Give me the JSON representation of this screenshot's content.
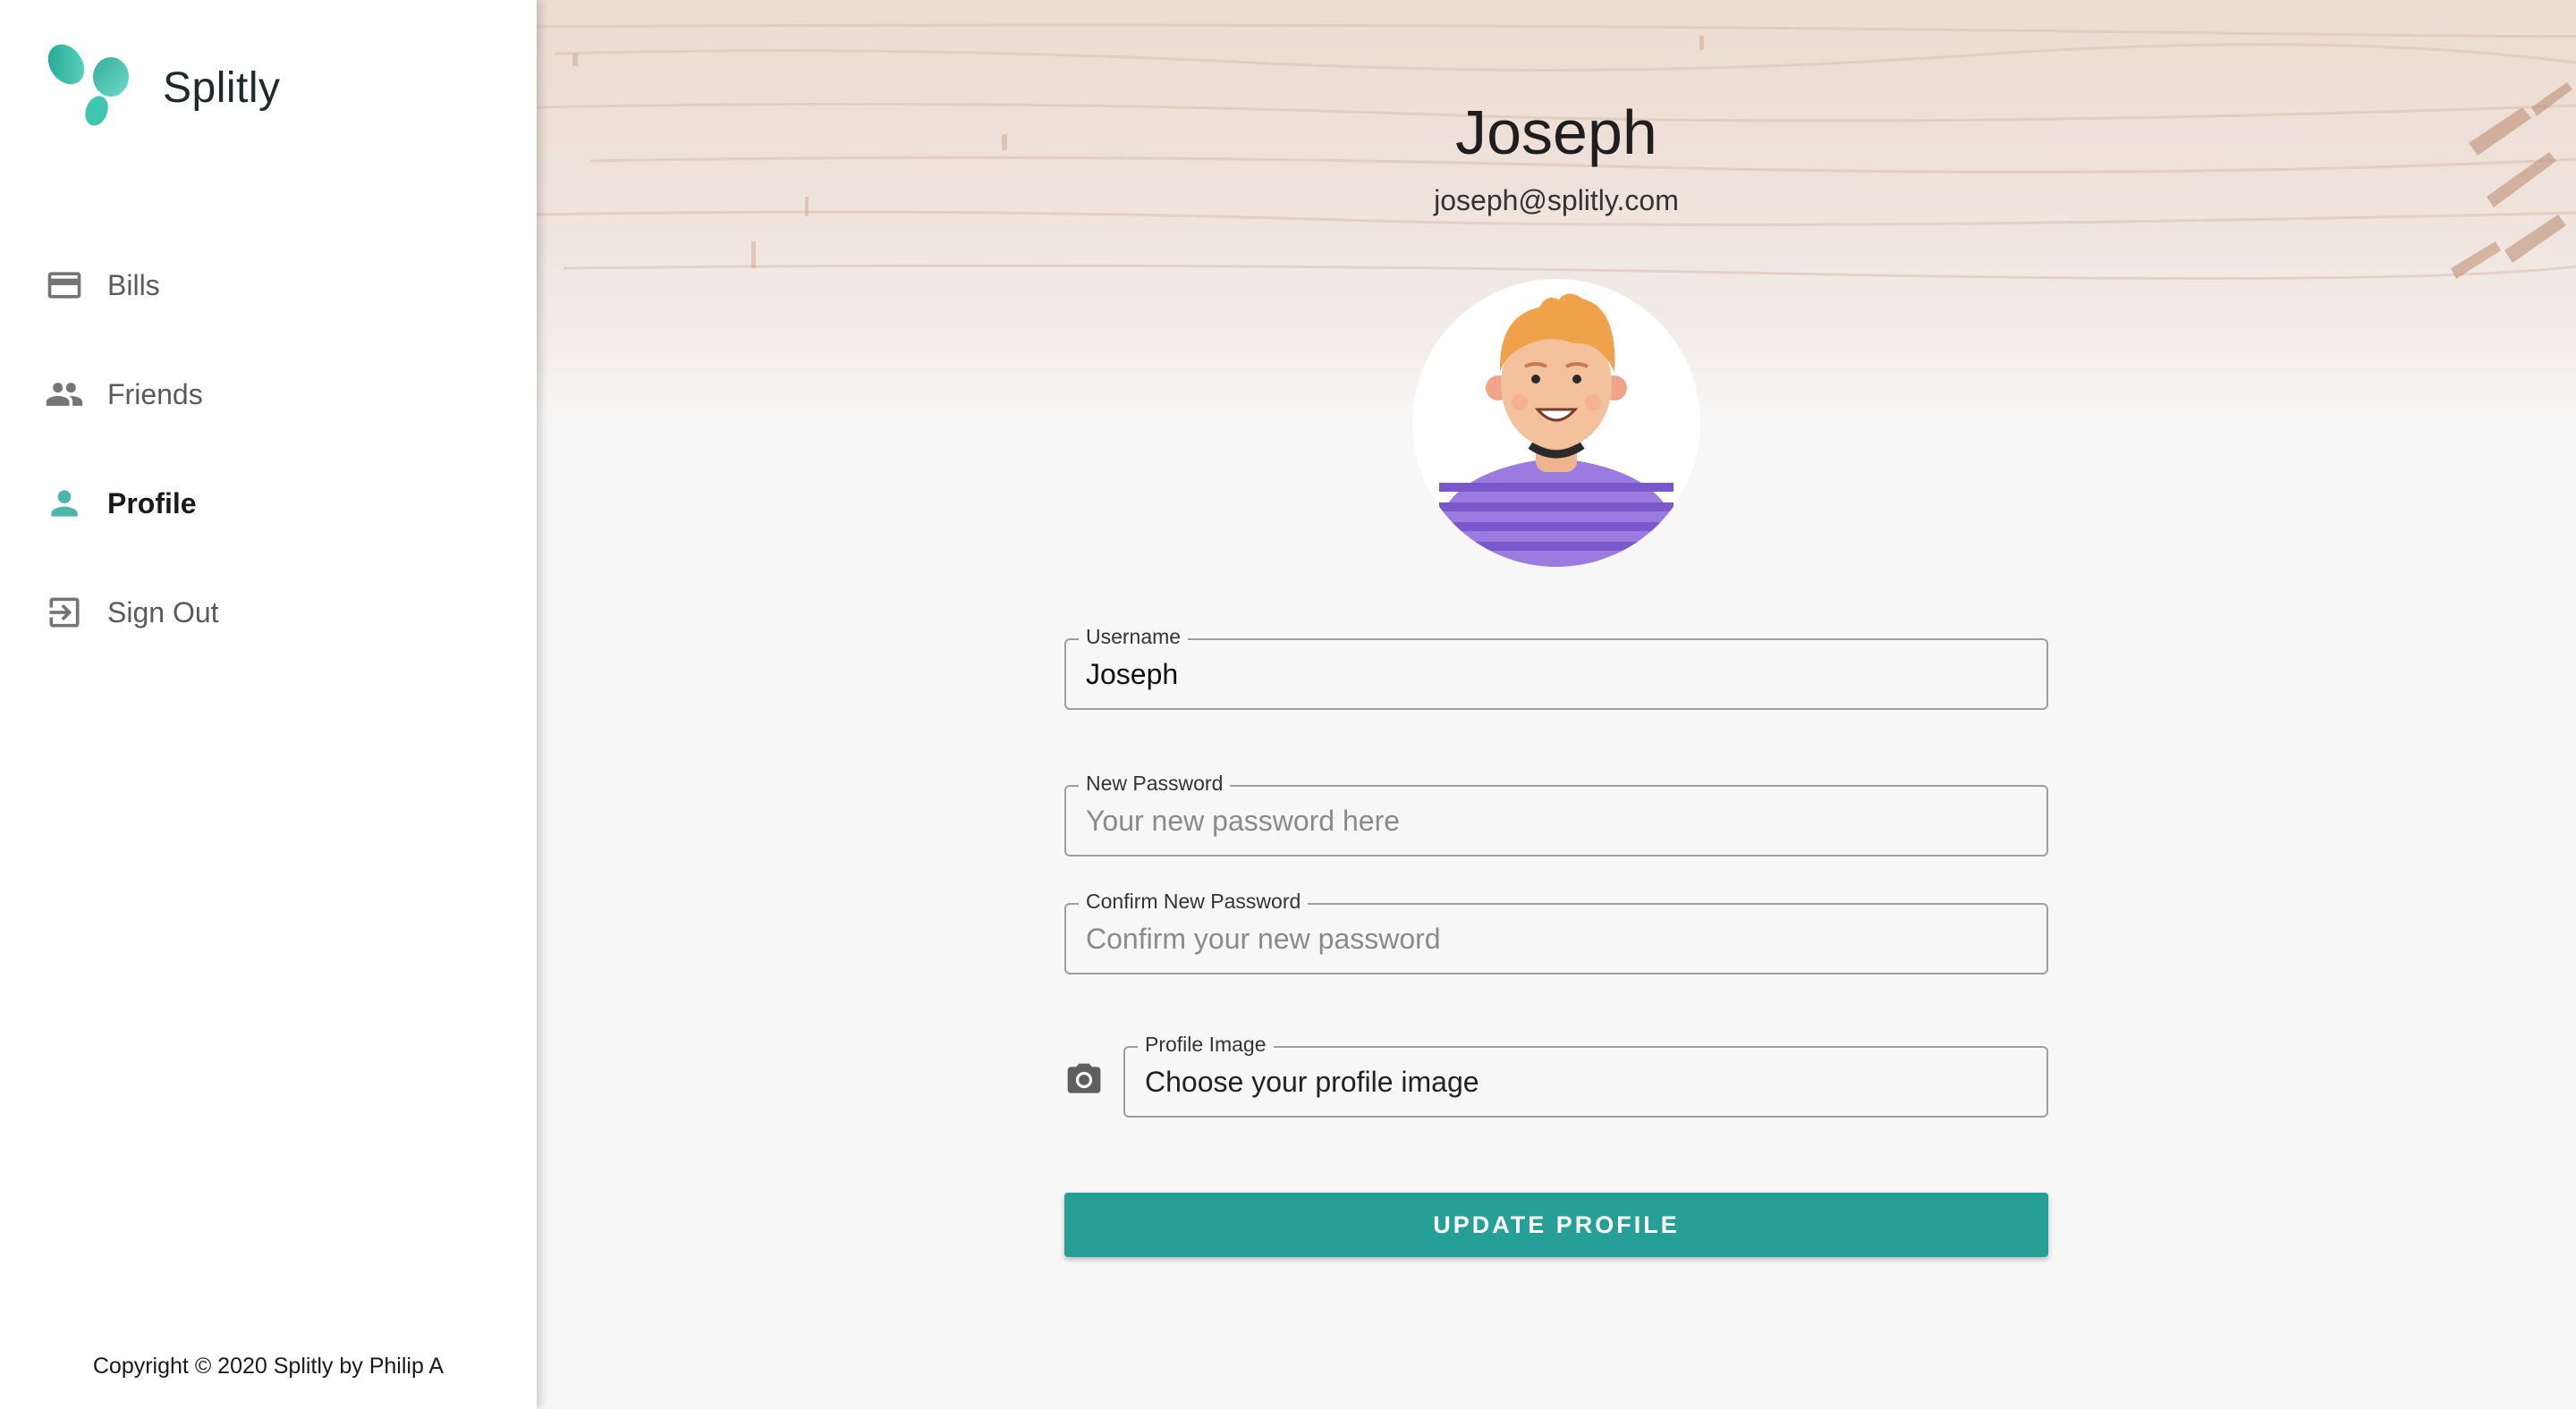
{
  "app": {
    "name": "Splitly"
  },
  "sidebar": {
    "items": [
      {
        "label": "Bills",
        "icon": "credit-card-icon",
        "active": false
      },
      {
        "label": "Friends",
        "icon": "people-icon",
        "active": false
      },
      {
        "label": "Profile",
        "icon": "person-icon",
        "active": true
      },
      {
        "label": "Sign Out",
        "icon": "exit-icon",
        "active": false
      }
    ],
    "copyright": "Copyright © 2020 Splitly by Philip A"
  },
  "profile": {
    "name": "Joseph",
    "email": "joseph@splitly.com",
    "avatar": "cartoon-avatar"
  },
  "form": {
    "username": {
      "label": "Username",
      "value": "Joseph",
      "placeholder": ""
    },
    "new_password": {
      "label": "New Password",
      "value": "",
      "placeholder": "Your new password here"
    },
    "confirm_password": {
      "label": "Confirm New Password",
      "value": "",
      "placeholder": "Confirm your new password"
    },
    "profile_image": {
      "label": "Profile Image",
      "value": "",
      "placeholder": "Choose your profile image",
      "icon": "camera-icon"
    },
    "submit_label": "UPDATE PROFILE"
  },
  "colors": {
    "accent": "#26a096",
    "active_icon": "#4db6ac",
    "inactive_icon": "#757575"
  }
}
